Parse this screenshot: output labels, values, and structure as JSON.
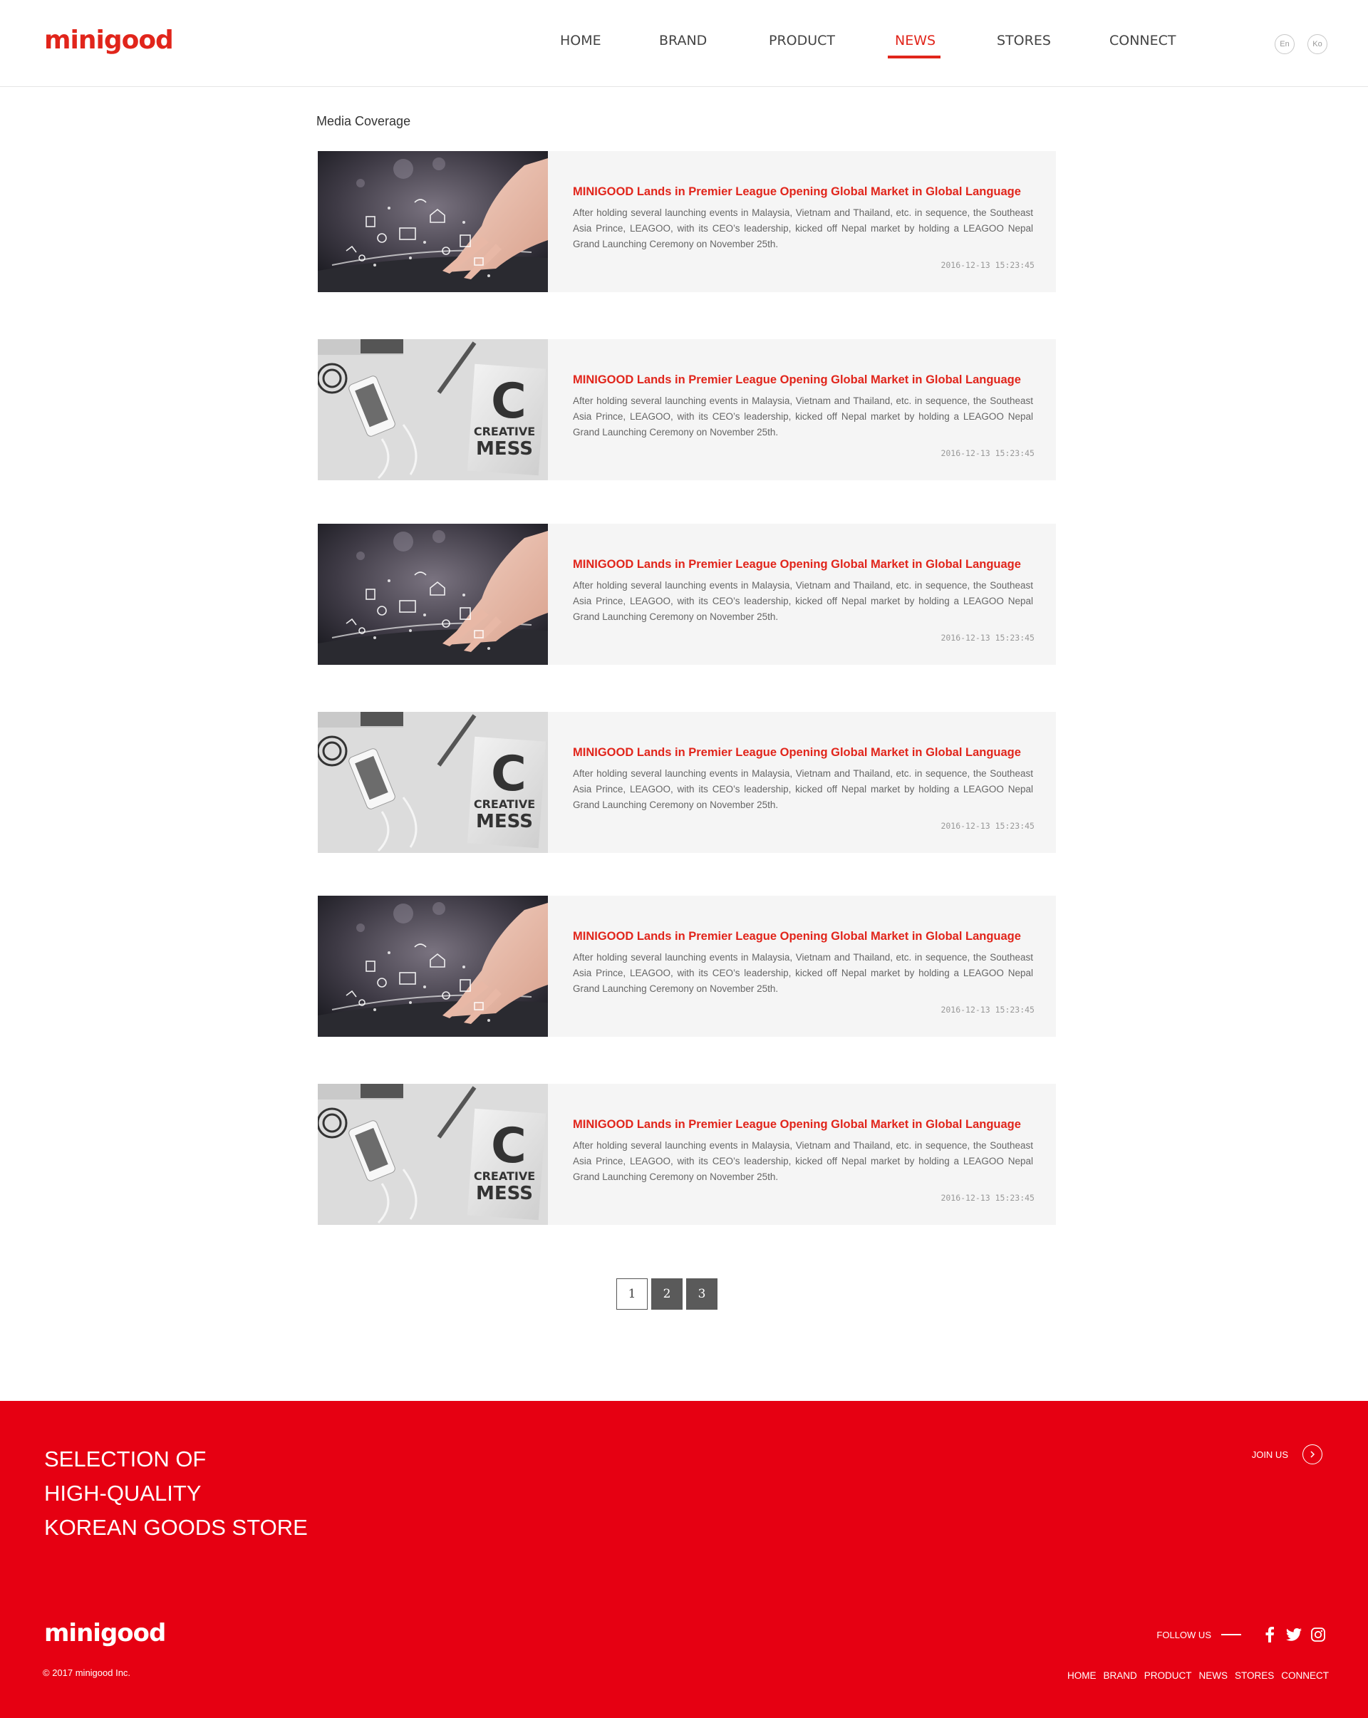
{
  "header": {
    "logo": "minigood",
    "nav": [
      "HOME",
      "BRAND",
      "PRODUCT",
      "NEWS",
      "STORES",
      "CONNECT"
    ],
    "active_nav": "NEWS",
    "languages": [
      "En",
      "Ko"
    ]
  },
  "main": {
    "section_title": "Media Coverage",
    "articles": [
      {
        "image": "tablet-hand-image",
        "title": "MINIGOOD Lands in Premier League Opening Global Market in Global Language",
        "excerpt": "After holding several launching events in Malaysia, Vietnam and Thailand, etc. in sequence, the Southeast Asia Prince, LEAGOO, with its CEO’s leadership, kicked off Nepal market by holding a LEAGOO Nepal Grand Launching Ceremony on November 25th.",
        "date": "2016-12-13 15:23:45"
      },
      {
        "image": "creative-mess-image",
        "image_text": [
          "C",
          "CREATIVE",
          "MESS"
        ],
        "title": "MINIGOOD Lands in Premier League Opening Global Market in Global Language",
        "excerpt": "After holding several launching events in Malaysia, Vietnam and Thailand, etc. in sequence, the Southeast Asia Prince, LEAGOO, with its CEO’s leadership, kicked off Nepal market by holding a LEAGOO Nepal Grand Launching Ceremony on November 25th.",
        "date": "2016-12-13 15:23:45"
      },
      {
        "image": "tablet-hand-image",
        "title": "MINIGOOD Lands in Premier League Opening Global Market in Global Language",
        "excerpt": "After holding several launching events in Malaysia, Vietnam and Thailand, etc. in sequence, the Southeast Asia Prince, LEAGOO, with its CEO’s leadership, kicked off Nepal market by holding a LEAGOO Nepal Grand Launching Ceremony on November 25th.",
        "date": "2016-12-13 15:23:45"
      },
      {
        "image": "creative-mess-image",
        "image_text": [
          "C",
          "CREATIVE",
          "MESS"
        ],
        "title": "MINIGOOD Lands in Premier League Opening Global Market in Global Language",
        "excerpt": "After holding several launching events in Malaysia, Vietnam and Thailand, etc. in sequence, the Southeast Asia Prince, LEAGOO, with its CEO’s leadership, kicked off Nepal market by holding a LEAGOO Nepal Grand Launching Ceremony on November 25th.",
        "date": "2016-12-13 15:23:45"
      },
      {
        "image": "tablet-hand-image",
        "title": "MINIGOOD Lands in Premier League Opening Global Market in Global Language",
        "excerpt": "After holding several launching events in Malaysia, Vietnam and Thailand, etc. in sequence, the Southeast Asia Prince, LEAGOO, with its CEO’s leadership, kicked off Nepal market by holding a LEAGOO Nepal Grand Launching Ceremony on November 25th.",
        "date": "2016-12-13 15:23:45"
      },
      {
        "image": "creative-mess-image",
        "image_text": [
          "C",
          "CREATIVE",
          "MESS"
        ],
        "title": "MINIGOOD Lands in Premier League Opening Global Market in Global Language",
        "excerpt": "After holding several launching events in Malaysia, Vietnam and Thailand, etc. in sequence, the Southeast Asia Prince, LEAGOO, with its CEO’s leadership, kicked off Nepal market by holding a LEAGOO Nepal Grand Launching Ceremony on November 25th.",
        "date": "2016-12-13 15:23:45"
      }
    ],
    "pagination": {
      "pages": [
        "1",
        "2",
        "3"
      ],
      "current": "1"
    }
  },
  "footer": {
    "tagline": [
      "SELECTION OF",
      "HIGH-QUALITY",
      "KOREAN GOODS STORE"
    ],
    "join_label": "JOIN US",
    "join_icon": "chevron-right-icon",
    "logo": "minigood",
    "copyright": "© 2017 minigood Inc.",
    "follow_label": "FOLLOW US",
    "social": [
      "facebook-icon",
      "twitter-icon",
      "instagram-icon"
    ],
    "nav": [
      "HOME",
      "BRAND",
      "PRODUCT",
      "NEWS",
      "STORES",
      "CONNECT"
    ]
  },
  "colors": {
    "brand_red": "#e1251b",
    "footer_red": "#e60012",
    "card_bg": "#f5f5f5",
    "pager_dark": "#5a5a5a"
  }
}
